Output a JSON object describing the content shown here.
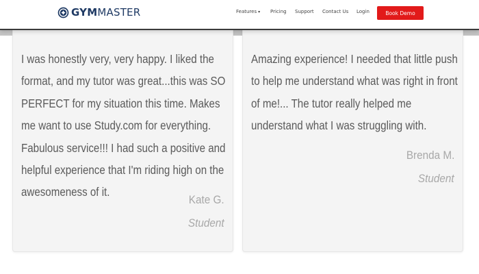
{
  "header": {
    "logo_gym": "GYM",
    "logo_master": "MASTER",
    "nav": [
      {
        "label": "Features",
        "has_dropdown": true
      },
      {
        "label": "Pricing",
        "has_dropdown": false
      },
      {
        "label": "Support",
        "has_dropdown": false
      },
      {
        "label": "Contact Us",
        "has_dropdown": false
      },
      {
        "label": "Login",
        "has_dropdown": false
      }
    ],
    "cta_label": "Book Demo",
    "colors": {
      "brand": "#1f3a64",
      "cta": "#e21a1a"
    }
  },
  "testimonials": [
    {
      "quote": "I was honestly very, very happy. I liked the format, and my tutor was great...this was SO PERFECT for my situation this time. Makes me want to use Study.com for everything. Fabulous service!!! I had such a positive and helpful experience that I'm riding high on the awesomeness of it.",
      "author": "Kate G.",
      "role": "Student"
    },
    {
      "quote": "Amazing experience! I needed that little push to help me understand what was right in front of me!... The tutor really helped me understand what I was struggling with.",
      "author": "Brenda M.",
      "role": "Student"
    }
  ]
}
